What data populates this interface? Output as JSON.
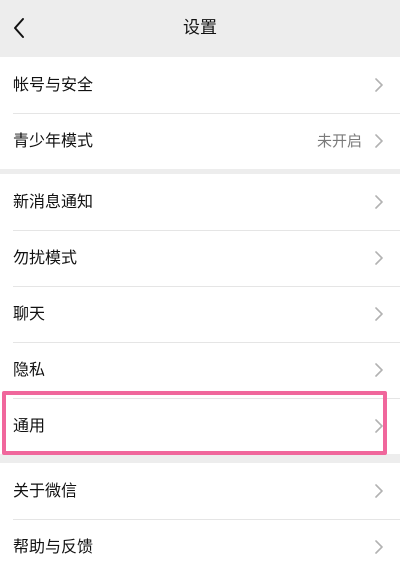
{
  "header": {
    "title": "设置",
    "back_icon": "chevron-left-icon"
  },
  "groups": [
    {
      "items": [
        {
          "label": "帐号与安全",
          "value": ""
        },
        {
          "label": "青少年模式",
          "value": "未开启"
        }
      ]
    },
    {
      "items": [
        {
          "label": "新消息通知",
          "value": ""
        },
        {
          "label": "勿扰模式",
          "value": ""
        },
        {
          "label": "聊天",
          "value": ""
        },
        {
          "label": "隐私",
          "value": ""
        },
        {
          "label": "通用",
          "value": ""
        }
      ]
    },
    {
      "items": [
        {
          "label": "关于微信",
          "value": ""
        },
        {
          "label": "帮助与反馈",
          "value": ""
        }
      ]
    }
  ],
  "highlight": {
    "target": "通用",
    "color": "#f0679c"
  },
  "colors": {
    "background": "#ededed",
    "row_background": "#ffffff",
    "chevron": "#b2b2b2"
  }
}
